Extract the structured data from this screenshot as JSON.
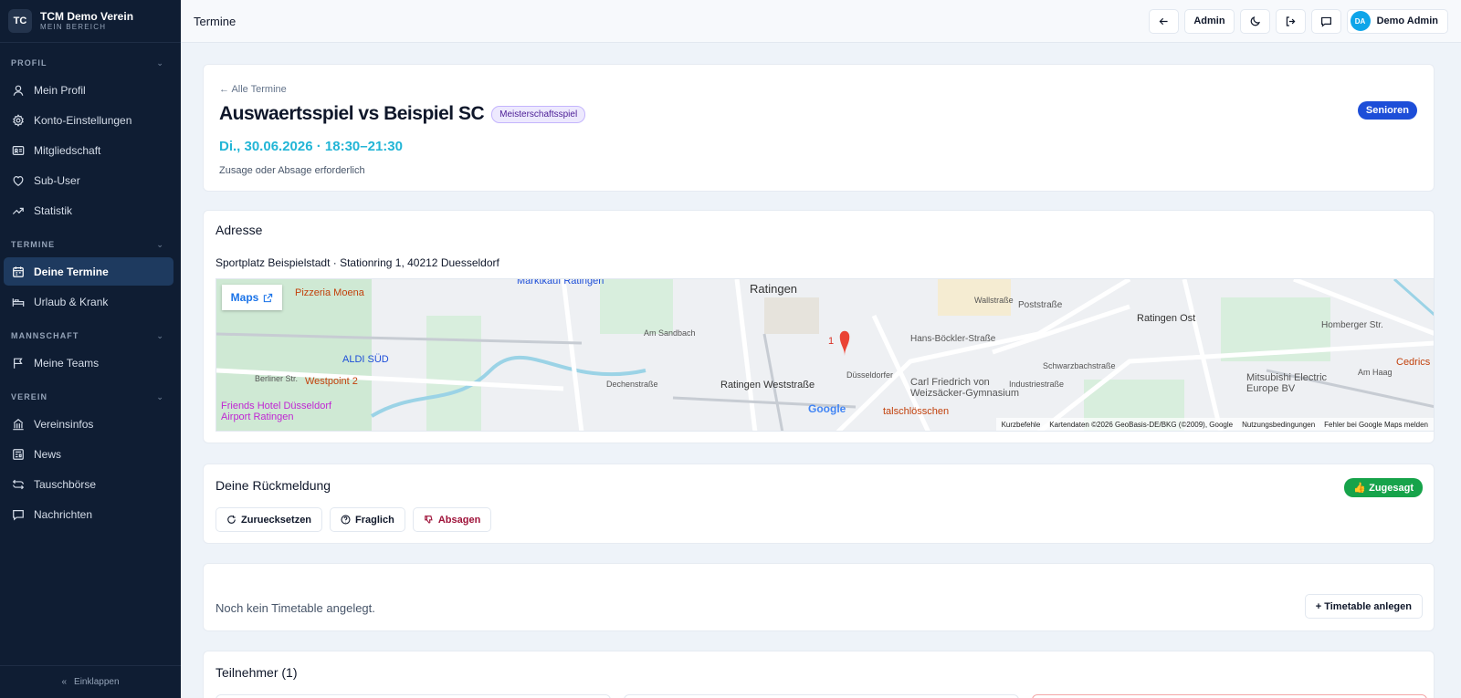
{
  "brand": {
    "logo": "TC",
    "name": "TCM Demo Verein",
    "subtitle": "MEIN BEREICH"
  },
  "sidebar": {
    "sections": [
      {
        "label": "PROFIL",
        "items": [
          {
            "label": "Mein Profil",
            "icon": "user-icon"
          },
          {
            "label": "Konto-Einstellungen",
            "icon": "gear-icon"
          },
          {
            "label": "Mitgliedschaft",
            "icon": "id-card-icon"
          },
          {
            "label": "Sub-User",
            "icon": "heart-icon"
          },
          {
            "label": "Statistik",
            "icon": "trend-icon"
          }
        ]
      },
      {
        "label": "TERMINE",
        "items": [
          {
            "label": "Deine Termine",
            "icon": "calendar-icon",
            "active": true
          },
          {
            "label": "Urlaub & Krank",
            "icon": "bed-icon"
          }
        ]
      },
      {
        "label": "MANNSCHAFT",
        "items": [
          {
            "label": "Meine Teams",
            "icon": "flag-icon"
          }
        ]
      },
      {
        "label": "VEREIN",
        "items": [
          {
            "label": "Vereinsinfos",
            "icon": "building-icon"
          },
          {
            "label": "News",
            "icon": "newspaper-icon"
          },
          {
            "label": "Tauschbörse",
            "icon": "swap-icon"
          },
          {
            "label": "Nachrichten",
            "icon": "message-icon"
          }
        ]
      }
    ],
    "collapse_label": "Einklappen"
  },
  "topbar": {
    "title": "Termine",
    "admin_label": "Admin",
    "user": {
      "initials": "DA",
      "name": "Demo Admin"
    }
  },
  "event": {
    "back_link": "← Alle Termine",
    "title": "Auswaertsspiel vs Beispiel SC",
    "type_badge": "Meisterschaftsspiel",
    "datetime": "Di., 30.06.2026 · 18:30–21:30",
    "note": "Zusage oder Absage erforderlich",
    "team_badge": "Senioren"
  },
  "address": {
    "title": "Adresse",
    "text": "Sportplatz Beispielstadt · Stationring 1, 40212 Duesseldorf",
    "maps_button": "Maps",
    "map_labels": [
      "Ratingen",
      "Pizzeria Moena",
      "ALDI SÜD",
      "Westpoint 2",
      "Berliner Str.",
      "Friends Hotel Düsseldorf",
      "Airport Ratingen",
      "Am Sandbach",
      "Dechenstraße",
      "Ratingen Weststraße",
      "Hans-Böckler-Straße",
      "Poststraße",
      "Carl Friedrich von",
      "Weizsäcker-Gymnasium",
      "Ratingen Ost",
      "Homberger Str.",
      "Mitsubishi Electric",
      "Europe BV",
      "Am Haag",
      "Cedrics",
      "talschlösschen",
      "Schwarzbachstraße",
      "Industriestraße",
      "Wallstraße",
      "Düsseldorfer",
      "Marktkauf Ratingen",
      "1"
    ],
    "map_footer": [
      "Kurzbefehle",
      "Kartendaten ©2026 GeoBasis-DE/BKG (©2009), Google",
      "Nutzungsbedingungen",
      "Fehler bei Google Maps melden"
    ],
    "map_logo": "Google"
  },
  "response": {
    "title": "Deine Rückmeldung",
    "status": "👍 Zugesagt",
    "buttons": {
      "reset": "Zuruecksetzen",
      "maybe": "Fraglich",
      "decline": "Absagen"
    }
  },
  "timetable": {
    "empty_text": "Noch kein Timetable angelegt.",
    "create_button": "+ Timetable anlegen"
  },
  "participants": {
    "title": "Teilnehmer (1)"
  }
}
